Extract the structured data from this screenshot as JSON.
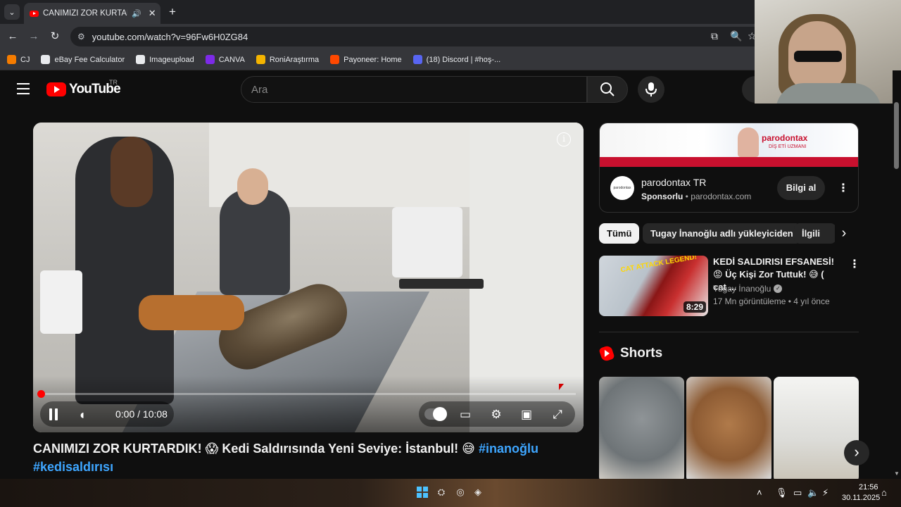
{
  "browser": {
    "tab_overview_icon": "chevron-down-icon",
    "tab_title": "CANIMIZI ZOR KURTARDIK",
    "new_tab_icon": "+",
    "url": "youtube.com/watch?v=96Fw6H0ZG84",
    "bookmarks": [
      {
        "label": "CJ",
        "color": "#f57c00"
      },
      {
        "label": "eBay Fee Calculator",
        "color": "#e8eaed"
      },
      {
        "label": "Imageupload",
        "color": "#e8eaed"
      },
      {
        "label": "CANVA",
        "color": "#7d2ae8"
      },
      {
        "label": "RoniAraştırma",
        "color": "#f4b400"
      },
      {
        "label": "Payoneer: Home",
        "color": "#ff4800"
      },
      {
        "label": "(18) Discord | #hoş-...",
        "color": "#5865f2"
      }
    ]
  },
  "header": {
    "logo_text": "YouTube",
    "country_code": "TR",
    "search_placeholder": "Ara"
  },
  "player": {
    "time": "0:00 / 10:08",
    "progress": 0,
    "state": "playing"
  },
  "video": {
    "title_main": "CANIMIZI ZOR KURTARDIK! 😱 Kedi Saldırısında Yeni Seviye: İstanbul! 😅 ",
    "hashtag_1": "#inanoğlu",
    "hashtag_2": "#kedisaldırısı"
  },
  "ad": {
    "banner_brand": "parodontax",
    "banner_tag": "DİŞ ETİ UZMANI",
    "logo_text": "parodontax",
    "name": "parodontax TR",
    "sponsored_label": "Sponsorlu",
    "domain": " • parodontax.com",
    "cta": "Bilgi al"
  },
  "chips": [
    "Tümü",
    "Tugay İnanoğlu adlı yükleyiciden",
    "İlgili"
  ],
  "suggested": {
    "title": "KEDİ SALDIRISI EFSANESİ! 😡 Üç Kişi Zor Tuttuk! 😅 ( cat ...",
    "channel": "Tugay İnanoğlu",
    "meta": "17 Mn görüntüleme • 4 yıl önce",
    "duration": "8:29",
    "thumb_caption": "CAT ATTACK LEGEND!"
  },
  "shorts": {
    "heading": "Shorts"
  },
  "taskbar": {
    "time": "21:56",
    "date": "30.11.2025"
  },
  "colors": {
    "accent": "#ff0000",
    "link": "#3ea6ff",
    "background": "#0f0f0f"
  }
}
